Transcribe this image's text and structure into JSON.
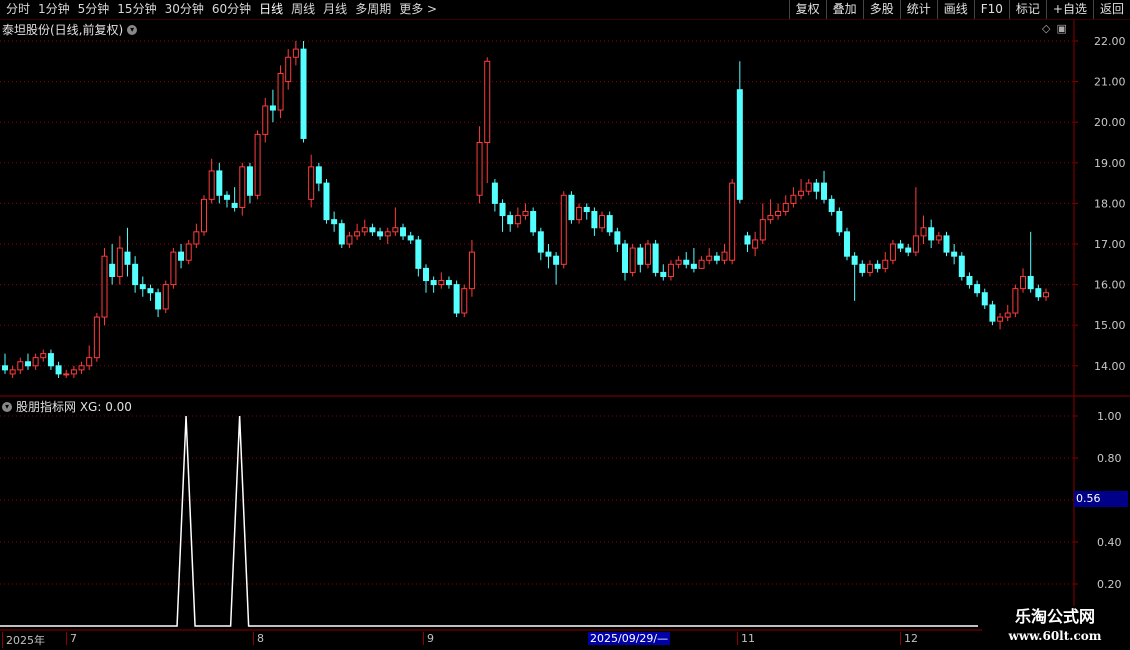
{
  "toolbar": {
    "periods": [
      "分时",
      "1分钟",
      "5分钟",
      "15分钟",
      "30分钟",
      "60分钟",
      "日线",
      "周线",
      "月线",
      "多周期",
      "更多 >"
    ],
    "active_period": "日线",
    "actions": [
      "复权",
      "叠加",
      "多股",
      "统计",
      "画线",
      "F10",
      "标记",
      "+自选",
      "返回"
    ]
  },
  "main": {
    "title": "泰坦股份(日线,前复权)",
    "price_ticks": [
      "22.00",
      "21.00",
      "20.00",
      "19.00",
      "18.00",
      "17.00",
      "16.00",
      "15.00",
      "14.00"
    ]
  },
  "indicator": {
    "title": "股朋指标网  XG: 0.00",
    "ticks": [
      "1.00",
      "0.80",
      "0.60",
      "0.40",
      "0.20"
    ],
    "current_value": "0.56"
  },
  "dates": {
    "labels": [
      "2025年",
      "7",
      "8",
      "9",
      "2025/09/29/—",
      "11",
      "12"
    ]
  },
  "watermark": {
    "line1": "乐淘公式网",
    "line2": "www.60lt.com"
  },
  "colors": {
    "up": "#ff3c3c",
    "down": "#54ffff",
    "grid": "#8b0000",
    "indicator_line": "#ffffff"
  },
  "chart_data": [
    {
      "type": "candlestick",
      "title": "泰坦股份(日线,前复权)",
      "ylim": [
        13.5,
        22.2
      ],
      "candles": [
        [
          14.0,
          13.9,
          14.3,
          13.8
        ],
        [
          13.8,
          13.9,
          14.0,
          13.7
        ],
        [
          13.9,
          14.1,
          14.2,
          13.8
        ],
        [
          14.1,
          14.0,
          14.3,
          13.9
        ],
        [
          14.0,
          14.2,
          14.3,
          13.9
        ],
        [
          14.2,
          14.3,
          14.4,
          14.1
        ],
        [
          14.3,
          14.0,
          14.4,
          13.9
        ],
        [
          14.0,
          13.8,
          14.1,
          13.7
        ],
        [
          13.8,
          13.8,
          13.9,
          13.7
        ],
        [
          13.8,
          13.9,
          14.0,
          13.7
        ],
        [
          13.9,
          14.0,
          14.1,
          13.8
        ],
        [
          14.0,
          14.2,
          14.5,
          13.9
        ],
        [
          14.2,
          15.2,
          15.3,
          14.1
        ],
        [
          15.2,
          16.7,
          16.9,
          15.0
        ],
        [
          16.5,
          16.2,
          17.0,
          16.0
        ],
        [
          16.2,
          16.9,
          17.2,
          16.0
        ],
        [
          16.8,
          16.5,
          17.4,
          16.2
        ],
        [
          16.5,
          16.0,
          16.7,
          15.8
        ],
        [
          16.0,
          15.9,
          16.2,
          15.7
        ],
        [
          15.9,
          15.8,
          16.0,
          15.6
        ],
        [
          15.8,
          15.4,
          15.9,
          15.2
        ],
        [
          15.4,
          16.0,
          16.1,
          15.3
        ],
        [
          16.0,
          16.8,
          16.9,
          15.9
        ],
        [
          16.8,
          16.6,
          17.0,
          16.4
        ],
        [
          16.6,
          17.0,
          17.1,
          16.5
        ],
        [
          17.0,
          17.3,
          17.5,
          16.9
        ],
        [
          17.3,
          18.1,
          18.2,
          17.2
        ],
        [
          18.1,
          18.8,
          19.1,
          18.0
        ],
        [
          18.8,
          18.2,
          19.0,
          18.0
        ],
        [
          18.2,
          18.1,
          18.3,
          17.9
        ],
        [
          18.0,
          17.9,
          18.4,
          17.8
        ],
        [
          17.9,
          18.9,
          19.0,
          17.7
        ],
        [
          18.9,
          18.2,
          19.0,
          18.0
        ],
        [
          18.2,
          19.7,
          19.8,
          18.1
        ],
        [
          19.7,
          20.4,
          20.6,
          19.5
        ],
        [
          20.4,
          20.3,
          20.8,
          20.0
        ],
        [
          20.3,
          21.2,
          21.4,
          20.1
        ],
        [
          21.0,
          21.6,
          21.8,
          20.8
        ],
        [
          21.6,
          21.8,
          22.0,
          21.4
        ],
        [
          21.8,
          19.6,
          22.0,
          19.5
        ],
        [
          18.1,
          18.9,
          19.2,
          17.9
        ],
        [
          18.9,
          18.5,
          19.0,
          18.3
        ],
        [
          18.5,
          17.6,
          18.6,
          17.5
        ],
        [
          17.6,
          17.5,
          17.8,
          17.3
        ],
        [
          17.5,
          17.0,
          17.6,
          16.9
        ],
        [
          17.0,
          17.2,
          17.3,
          16.9
        ],
        [
          17.2,
          17.3,
          17.5,
          17.1
        ],
        [
          17.3,
          17.4,
          17.6,
          17.2
        ],
        [
          17.4,
          17.3,
          17.5,
          17.2
        ],
        [
          17.3,
          17.2,
          17.4,
          17.1
        ],
        [
          17.2,
          17.3,
          17.4,
          17.0
        ],
        [
          17.3,
          17.4,
          17.9,
          17.2
        ],
        [
          17.4,
          17.2,
          17.5,
          17.1
        ],
        [
          17.2,
          17.1,
          17.3,
          17.0
        ],
        [
          17.1,
          16.4,
          17.2,
          16.2
        ],
        [
          16.4,
          16.1,
          16.5,
          15.8
        ],
        [
          16.1,
          16.0,
          16.2,
          15.8
        ],
        [
          16.0,
          16.1,
          16.3,
          15.9
        ],
        [
          16.1,
          16.0,
          16.2,
          15.9
        ],
        [
          16.0,
          15.3,
          16.1,
          15.2
        ],
        [
          15.3,
          15.9,
          16.0,
          15.2
        ],
        [
          15.9,
          16.8,
          17.1,
          15.7
        ],
        [
          18.2,
          19.5,
          19.9,
          18.0
        ],
        [
          19.5,
          21.5,
          21.6,
          18.5
        ],
        [
          18.5,
          18.0,
          18.6,
          17.8
        ],
        [
          18.0,
          17.7,
          18.1,
          17.3
        ],
        [
          17.7,
          17.5,
          17.8,
          17.3
        ],
        [
          17.5,
          17.7,
          17.9,
          17.4
        ],
        [
          17.7,
          17.8,
          18.0,
          17.6
        ],
        [
          17.8,
          17.3,
          17.9,
          17.2
        ],
        [
          17.3,
          16.8,
          17.4,
          16.6
        ],
        [
          16.8,
          16.7,
          17.0,
          16.4
        ],
        [
          16.7,
          16.5,
          16.8,
          16.0
        ],
        [
          16.5,
          18.2,
          18.3,
          16.4
        ],
        [
          18.2,
          17.6,
          18.3,
          17.5
        ],
        [
          17.6,
          17.9,
          18.0,
          17.5
        ],
        [
          17.9,
          17.8,
          18.0,
          17.6
        ],
        [
          17.8,
          17.4,
          17.9,
          17.2
        ],
        [
          17.4,
          17.7,
          17.8,
          17.3
        ],
        [
          17.7,
          17.3,
          17.8,
          17.2
        ],
        [
          17.3,
          17.0,
          17.4,
          16.8
        ],
        [
          17.0,
          16.3,
          17.1,
          16.1
        ],
        [
          16.3,
          16.9,
          17.0,
          16.2
        ],
        [
          16.9,
          16.5,
          17.0,
          16.3
        ],
        [
          16.5,
          17.0,
          17.1,
          16.4
        ],
        [
          17.0,
          16.3,
          17.1,
          16.2
        ],
        [
          16.3,
          16.2,
          16.5,
          16.1
        ],
        [
          16.2,
          16.5,
          16.6,
          16.1
        ],
        [
          16.5,
          16.6,
          16.7,
          16.4
        ],
        [
          16.6,
          16.5,
          16.8,
          16.4
        ],
        [
          16.5,
          16.4,
          16.9,
          16.3
        ],
        [
          16.4,
          16.6,
          16.7,
          16.4
        ],
        [
          16.6,
          16.7,
          16.9,
          16.5
        ],
        [
          16.7,
          16.6,
          16.8,
          16.5
        ],
        [
          16.6,
          16.8,
          17.0,
          16.5
        ],
        [
          16.6,
          18.5,
          18.6,
          16.5
        ],
        [
          20.8,
          18.1,
          21.5,
          18.0
        ],
        [
          17.2,
          17.0,
          17.3,
          16.8
        ],
        [
          16.9,
          17.1,
          17.3,
          16.7
        ],
        [
          17.1,
          17.6,
          18.0,
          17.0
        ],
        [
          17.6,
          17.7,
          18.1,
          17.5
        ],
        [
          17.7,
          17.8,
          18.0,
          17.6
        ],
        [
          17.8,
          18.0,
          18.2,
          17.7
        ],
        [
          18.0,
          18.2,
          18.4,
          17.9
        ],
        [
          18.2,
          18.3,
          18.6,
          18.1
        ],
        [
          18.3,
          18.5,
          18.6,
          18.2
        ],
        [
          18.5,
          18.3,
          18.6,
          18.1
        ],
        [
          18.5,
          18.1,
          18.8,
          18.0
        ],
        [
          18.1,
          17.8,
          18.2,
          17.7
        ],
        [
          17.8,
          17.3,
          17.9,
          17.2
        ],
        [
          17.3,
          16.7,
          17.4,
          16.6
        ],
        [
          16.7,
          16.5,
          16.8,
          15.6
        ],
        [
          16.5,
          16.3,
          16.6,
          16.2
        ],
        [
          16.3,
          16.5,
          16.6,
          16.2
        ],
        [
          16.5,
          16.4,
          16.6,
          16.3
        ],
        [
          16.4,
          16.6,
          16.8,
          16.3
        ],
        [
          16.6,
          17.0,
          17.1,
          16.5
        ],
        [
          17.0,
          16.9,
          17.1,
          16.8
        ],
        [
          16.9,
          16.8,
          17.0,
          16.7
        ],
        [
          16.8,
          17.2,
          18.4,
          16.7
        ],
        [
          17.2,
          17.4,
          17.7,
          17.0
        ],
        [
          17.4,
          17.1,
          17.6,
          16.9
        ],
        [
          17.1,
          17.2,
          17.3,
          17.0
        ],
        [
          17.2,
          16.8,
          17.3,
          16.7
        ],
        [
          16.8,
          16.7,
          17.0,
          16.5
        ],
        [
          16.7,
          16.2,
          16.8,
          16.1
        ],
        [
          16.2,
          16.0,
          16.3,
          15.9
        ],
        [
          16.0,
          15.8,
          16.1,
          15.7
        ],
        [
          15.8,
          15.5,
          15.9,
          15.4
        ],
        [
          15.5,
          15.1,
          15.6,
          15.0
        ],
        [
          15.1,
          15.2,
          15.3,
          14.9
        ],
        [
          15.2,
          15.3,
          15.5,
          15.1
        ],
        [
          15.3,
          15.9,
          16.0,
          15.2
        ],
        [
          15.9,
          16.2,
          16.4,
          15.8
        ],
        [
          16.2,
          15.9,
          17.3,
          15.8
        ],
        [
          15.9,
          15.7,
          16.0,
          15.6
        ],
        [
          15.7,
          15.8,
          15.9,
          15.6
        ]
      ]
    },
    {
      "type": "line",
      "title": "股朋指标网  XG: 0.00",
      "ylim": [
        0,
        1.05
      ],
      "spikes_at_candle_index": [
        23,
        30
      ],
      "values_note_free": true,
      "values": [
        0,
        1,
        0
      ]
    }
  ]
}
